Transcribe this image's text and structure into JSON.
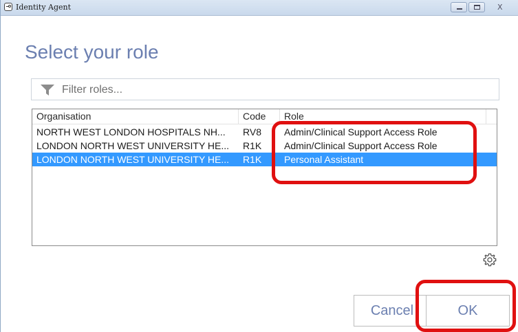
{
  "window": {
    "title": "Identity Agent",
    "close_glyph": "X"
  },
  "heading": "Select your role",
  "filter": {
    "icon": "filter-icon",
    "placeholder": "Filter roles..."
  },
  "table": {
    "columns": [
      "Organisation",
      "Code",
      "Role"
    ],
    "rows": [
      {
        "organisation": "NORTH WEST LONDON HOSPITALS NH...",
        "code": "RV8",
        "role": "Admin/Clinical Support Access Role",
        "selected": false
      },
      {
        "organisation": "LONDON NORTH WEST UNIVERSITY HE...",
        "code": "R1K",
        "role": "Admin/Clinical Support Access Role",
        "selected": false
      },
      {
        "organisation": "LONDON NORTH WEST UNIVERSITY HE...",
        "code": "R1K",
        "role": "Personal Assistant",
        "selected": true
      }
    ]
  },
  "settings_icon": "gear-icon",
  "buttons": {
    "cancel": "Cancel",
    "ok": "OK"
  },
  "colors": {
    "accent_text": "#6b7fb0",
    "selection": "#3399ff",
    "annotation": "#e01010"
  }
}
